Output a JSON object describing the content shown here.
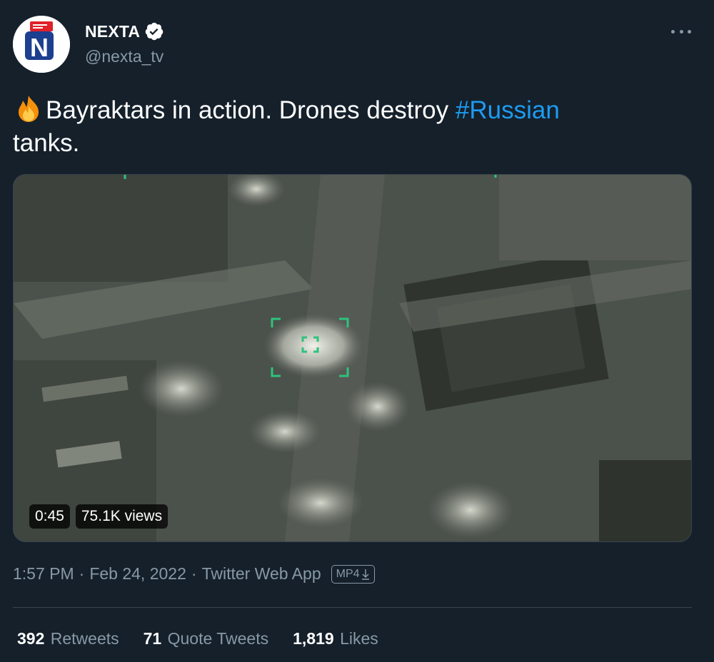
{
  "author": {
    "name": "NEXTA",
    "handle": "@nexta_tv",
    "verified": true,
    "avatar_icon": "nexta-logo",
    "avatar_letter": "N"
  },
  "tweet": {
    "emoji": "fire-emoji",
    "text_main": "Bayraktars in action. Drones destroy ",
    "hashtag": "#Russian",
    "text_end": "tanks."
  },
  "media": {
    "duration": "0:45",
    "views": "75.1K views"
  },
  "meta": {
    "time": "1:57 PM",
    "separator": "·",
    "date": "Feb 24, 2022",
    "source": "Twitter Web App",
    "mp4_label": "MP4"
  },
  "stats": [
    {
      "count": "392",
      "label": "Retweets"
    },
    {
      "count": "71",
      "label": "Quote Tweets"
    },
    {
      "count": "1,819",
      "label": "Likes"
    }
  ],
  "colors": {
    "background": "#15202b",
    "link": "#1d9bf0",
    "muted": "#8899a6",
    "border": "#38444d",
    "brand_red": "#e0202a",
    "brand_blue": "#1d3f8f"
  }
}
